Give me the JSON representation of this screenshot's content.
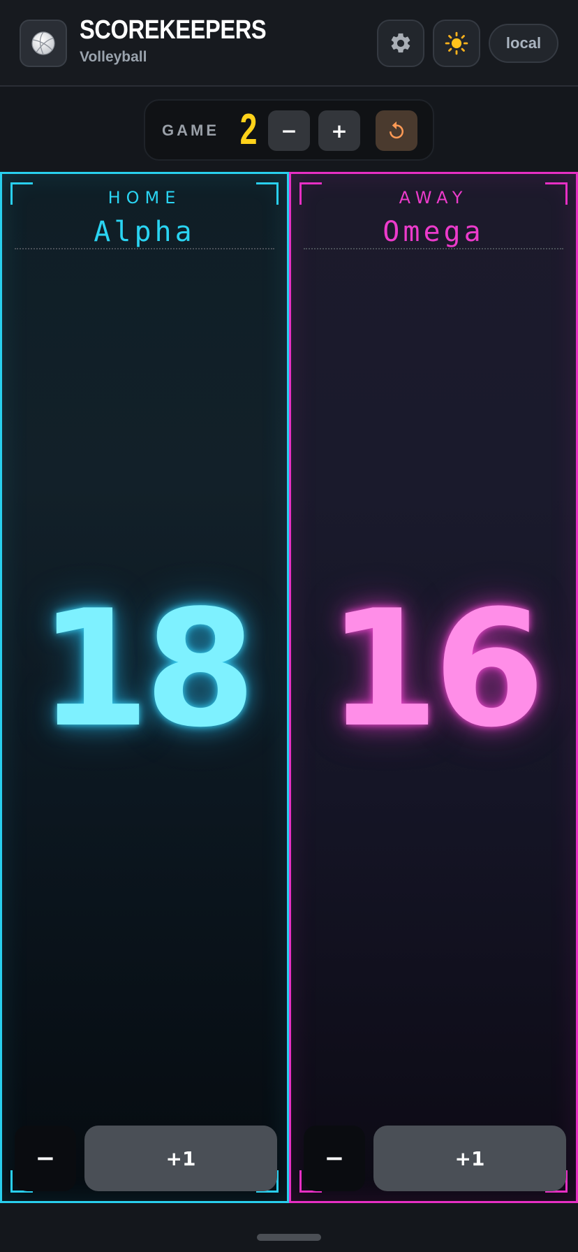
{
  "header": {
    "title": "SCOREKEEPERS",
    "subtitle": "Volleyball",
    "logo_icon": "volleyball-icon",
    "settings_icon": "gear-icon",
    "theme_icon": "sun-icon",
    "mode_label": "local"
  },
  "game": {
    "label": "GAME",
    "number": "2",
    "minus_label": "−",
    "plus_label": "+",
    "reset_icon": "reset-icon"
  },
  "teams": [
    {
      "side": "HOME",
      "name": "Alpha",
      "score": "18",
      "minus_label": "−",
      "plus_label": "+1",
      "color": "#29cfee"
    },
    {
      "side": "AWAY",
      "name": "Omega",
      "score": "16",
      "minus_label": "−",
      "plus_label": "+1",
      "color": "#e72fc4"
    }
  ]
}
